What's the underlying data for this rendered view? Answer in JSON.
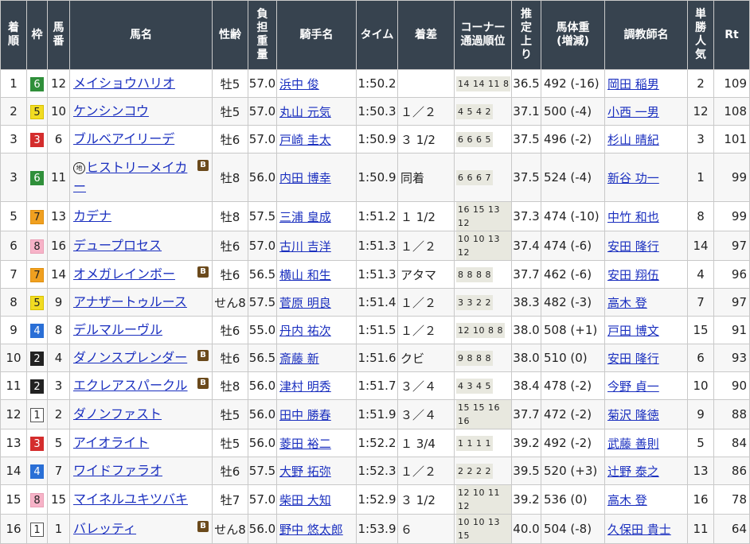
{
  "headers": {
    "rank": "着順",
    "waku": "枠",
    "num": "馬番",
    "name": "馬名",
    "sexage": "性齢",
    "weight": "負担重量",
    "jockey": "騎手名",
    "time": "タイム",
    "margin": "着差",
    "corner": "コーナー通過順位",
    "last3f": "推定上り",
    "bodyweight": "馬体重(増減)",
    "trainer": "調教師名",
    "pop": "単勝人気",
    "rt": "Rt"
  },
  "header_lines": {
    "rank": [
      "着",
      "順"
    ],
    "num": [
      "馬",
      "番"
    ],
    "weight": [
      "負",
      "担",
      "重",
      "量"
    ],
    "corner": [
      "コーナー",
      "通過順位"
    ],
    "last3f": [
      "推",
      "定",
      "上",
      "り"
    ],
    "bodyweight": [
      "馬体重",
      "(増減)"
    ],
    "pop": [
      "単",
      "勝",
      "人",
      "気"
    ]
  },
  "waku_colors": {
    "1": {
      "bg": "#ffffff",
      "fg": "#222222",
      "border": "#555555"
    },
    "2": {
      "bg": "#222222",
      "fg": "#ffffff",
      "border": "#222222"
    },
    "3": {
      "bg": "#d42d2d",
      "fg": "#ffffff",
      "border": "#d42d2d"
    },
    "4": {
      "bg": "#2a6fd6",
      "fg": "#ffffff",
      "border": "#2a6fd6"
    },
    "5": {
      "bg": "#f2dc22",
      "fg": "#222222",
      "border": "#d8c200"
    },
    "6": {
      "bg": "#2f8f3a",
      "fg": "#ffffff",
      "border": "#2f8f3a"
    },
    "7": {
      "bg": "#f0a020",
      "fg": "#222222",
      "border": "#e09010"
    },
    "8": {
      "bg": "#f7b3c8",
      "fg": "#222222",
      "border": "#eaa0b6"
    }
  },
  "rows": [
    {
      "rank": "1",
      "waku": "6",
      "num": "12",
      "name": "メイショウハリオ",
      "blinker": false,
      "chi": false,
      "sexage": "牡5",
      "weight": "57.0",
      "jockey": "浜中 俊",
      "time": "1:50.2",
      "margin": "",
      "corner": "14 14 11 8",
      "last3f": "36.5",
      "bodyweight": "492 (-16)",
      "trainer": "岡田 稲男",
      "pop": "2",
      "rt": "109"
    },
    {
      "rank": "2",
      "waku": "5",
      "num": "10",
      "name": "ケンシンコウ",
      "blinker": false,
      "chi": false,
      "sexage": "牡5",
      "weight": "57.0",
      "jockey": "丸山 元気",
      "time": "1:50.3",
      "margin": "１／２",
      "corner": "4 5 4 2",
      "last3f": "37.1",
      "bodyweight": "500 (-4)",
      "trainer": "小西 一男",
      "pop": "12",
      "rt": "108"
    },
    {
      "rank": "3",
      "waku": "3",
      "num": "6",
      "name": "ブルベアイリーデ",
      "blinker": false,
      "chi": false,
      "sexage": "牡6",
      "weight": "57.0",
      "jockey": "戸崎 圭太",
      "time": "1:50.9",
      "margin": "３ 1/2",
      "corner": "6 6 6 5",
      "last3f": "37.5",
      "bodyweight": "496 (-2)",
      "trainer": "杉山 晴紀",
      "pop": "3",
      "rt": "101"
    },
    {
      "rank": "3",
      "waku": "6",
      "num": "11",
      "name": "ヒストリーメイカー",
      "blinker": true,
      "chi": true,
      "sexage": "牡8",
      "weight": "56.0",
      "jockey": "内田 博幸",
      "time": "1:50.9",
      "margin": "同着",
      "corner": "6 6 6 7",
      "last3f": "37.5",
      "bodyweight": "524 (-4)",
      "trainer": "新谷 功一",
      "pop": "1",
      "rt": "99"
    },
    {
      "rank": "5",
      "waku": "7",
      "num": "13",
      "name": "カデナ",
      "blinker": false,
      "chi": false,
      "sexage": "牡8",
      "weight": "57.5",
      "jockey": "三浦 皇成",
      "time": "1:51.2",
      "margin": "１ 1/2",
      "corner": "16 15 13 12",
      "last3f": "37.3",
      "bodyweight": "474 (-10)",
      "trainer": "中竹 和也",
      "pop": "8",
      "rt": "99"
    },
    {
      "rank": "6",
      "waku": "8",
      "num": "16",
      "name": "デュープロセス",
      "blinker": false,
      "chi": false,
      "sexage": "牡6",
      "weight": "57.0",
      "jockey": "古川 吉洋",
      "time": "1:51.3",
      "margin": "１／２",
      "corner": "10 10 13 12",
      "last3f": "37.4",
      "bodyweight": "474 (-6)",
      "trainer": "安田 隆行",
      "pop": "14",
      "rt": "97"
    },
    {
      "rank": "7",
      "waku": "7",
      "num": "14",
      "name": "オメガレインボー",
      "blinker": true,
      "chi": false,
      "sexage": "牡6",
      "weight": "56.5",
      "jockey": "横山 和生",
      "time": "1:51.3",
      "margin": "アタマ",
      "corner": "8 8 8 8",
      "last3f": "37.7",
      "bodyweight": "462 (-6)",
      "trainer": "安田 翔伍",
      "pop": "4",
      "rt": "96"
    },
    {
      "rank": "8",
      "waku": "5",
      "num": "9",
      "name": "アナザートゥルース",
      "blinker": false,
      "chi": false,
      "sexage": "せん8",
      "weight": "57.5",
      "jockey": "菅原 明良",
      "time": "1:51.4",
      "margin": "１／２",
      "corner": "3 3 2 2",
      "last3f": "38.3",
      "bodyweight": "482 (-3)",
      "trainer": "高木 登",
      "pop": "7",
      "rt": "97"
    },
    {
      "rank": "9",
      "waku": "4",
      "num": "8",
      "name": "デルマルーヴル",
      "blinker": false,
      "chi": false,
      "sexage": "牡6",
      "weight": "55.0",
      "jockey": "丹内 祐次",
      "time": "1:51.5",
      "margin": "１／２",
      "corner": "12 10 8 8",
      "last3f": "38.0",
      "bodyweight": "508 (+1)",
      "trainer": "戸田 博文",
      "pop": "15",
      "rt": "91"
    },
    {
      "rank": "10",
      "waku": "2",
      "num": "4",
      "name": "ダノンスプレンダー",
      "blinker": true,
      "chi": false,
      "sexage": "牡6",
      "weight": "56.5",
      "jockey": "斎藤 新",
      "time": "1:51.6",
      "margin": "クビ",
      "corner": "9 8 8 8",
      "last3f": "38.0",
      "bodyweight": "510 (0)",
      "trainer": "安田 隆行",
      "pop": "6",
      "rt": "93"
    },
    {
      "rank": "11",
      "waku": "2",
      "num": "3",
      "name": "エクレアスパークル",
      "blinker": true,
      "chi": false,
      "sexage": "牡8",
      "weight": "56.0",
      "jockey": "津村 明秀",
      "time": "1:51.7",
      "margin": "３／４",
      "corner": "4 3 4 5",
      "last3f": "38.4",
      "bodyweight": "478 (-2)",
      "trainer": "今野 貞一",
      "pop": "10",
      "rt": "90"
    },
    {
      "rank": "12",
      "waku": "1",
      "num": "2",
      "name": "ダノンファスト",
      "blinker": false,
      "chi": false,
      "sexage": "牡5",
      "weight": "56.0",
      "jockey": "田中 勝春",
      "time": "1:51.9",
      "margin": "３／４",
      "corner": "15 15 16 16",
      "last3f": "37.7",
      "bodyweight": "472 (-2)",
      "trainer": "菊沢 隆徳",
      "pop": "9",
      "rt": "88"
    },
    {
      "rank": "13",
      "waku": "3",
      "num": "5",
      "name": "アイオライト",
      "blinker": false,
      "chi": false,
      "sexage": "牡5",
      "weight": "56.0",
      "jockey": "菱田 裕二",
      "time": "1:52.2",
      "margin": "１ 3/4",
      "corner": "1 1 1 1",
      "last3f": "39.2",
      "bodyweight": "492 (-2)",
      "trainer": "武藤 善則",
      "pop": "5",
      "rt": "84"
    },
    {
      "rank": "14",
      "waku": "4",
      "num": "7",
      "name": "ワイドファラオ",
      "blinker": false,
      "chi": false,
      "sexage": "牡6",
      "weight": "57.5",
      "jockey": "大野 拓弥",
      "time": "1:52.3",
      "margin": "１／２",
      "corner": "2 2 2 2",
      "last3f": "39.5",
      "bodyweight": "520 (+3)",
      "trainer": "辻野 泰之",
      "pop": "13",
      "rt": "86"
    },
    {
      "rank": "15",
      "waku": "8",
      "num": "15",
      "name": "マイネルユキツバキ",
      "blinker": false,
      "chi": false,
      "sexage": "牡7",
      "weight": "57.0",
      "jockey": "柴田 大知",
      "time": "1:52.9",
      "margin": "３ 1/2",
      "corner": "12 10 11 12",
      "last3f": "39.2",
      "bodyweight": "536 (0)",
      "trainer": "高木 登",
      "pop": "16",
      "rt": "78"
    },
    {
      "rank": "16",
      "waku": "1",
      "num": "1",
      "name": "バレッティ",
      "blinker": true,
      "chi": false,
      "sexage": "せん8",
      "weight": "56.0",
      "jockey": "野中 悠太郎",
      "time": "1:53.9",
      "margin": "６",
      "corner": "10 10 13 15",
      "last3f": "40.0",
      "bodyweight": "504 (-8)",
      "trainer": "久保田 貴士",
      "pop": "11",
      "rt": "64"
    }
  ],
  "icons": {
    "blinker": "B",
    "chi": "地"
  }
}
